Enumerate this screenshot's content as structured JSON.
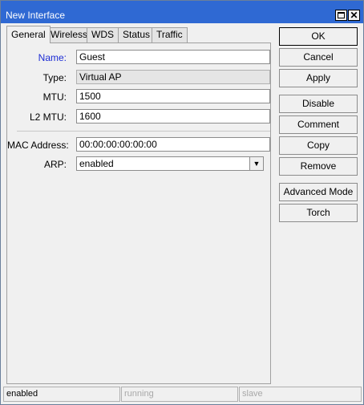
{
  "window": {
    "title": "New Interface"
  },
  "tabs": [
    "General",
    "Wireless",
    "WDS",
    "Status",
    "Traffic"
  ],
  "form": {
    "name": {
      "label": "Name:",
      "value": "Guest"
    },
    "type": {
      "label": "Type:",
      "value": "Virtual AP"
    },
    "mtu": {
      "label": "MTU:",
      "value": "1500"
    },
    "l2mtu": {
      "label": "L2 MTU:",
      "value": "1600"
    },
    "mac": {
      "label": "MAC Address:",
      "value": "00:00:00:00:00:00"
    },
    "arp": {
      "label": "ARP:",
      "value": "enabled"
    }
  },
  "buttons": {
    "ok": "OK",
    "cancel": "Cancel",
    "apply": "Apply",
    "disable": "Disable",
    "comment": "Comment",
    "copy": "Copy",
    "remove": "Remove",
    "advanced": "Advanced Mode",
    "torch": "Torch"
  },
  "status": [
    "enabled",
    "running",
    "slave"
  ],
  "colors": {
    "titlebar": "#2f69d3",
    "highlight_label": "#1c2cd4"
  }
}
